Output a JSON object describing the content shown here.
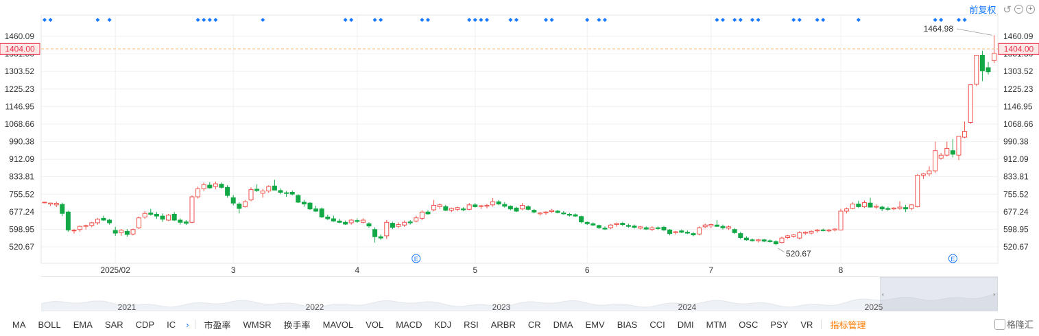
{
  "header": {
    "adjust_label": "前复权"
  },
  "icons": {
    "undo": "undo-icon",
    "zoom_out": "zoom-out-icon",
    "zoom_in": "zoom-in-icon",
    "event": "event-marker-icon",
    "dividend": "dividend-marker-icon"
  },
  "colors": {
    "up": "#f0504a",
    "down": "#12a846",
    "accent": "#1677ff",
    "price_line": "#f5a35a",
    "price_tag": "#e8344b"
  },
  "current_price": {
    "label": "1404.00",
    "value": 1404.0
  },
  "chart_data": {
    "type": "candlestick",
    "ylim": [
      480,
      1500
    ],
    "y_ticks": [
      "1460.09",
      "1381.80",
      "1303.52",
      "1225.23",
      "1146.95",
      "1068.66",
      "990.38",
      "912.09",
      "833.81",
      "755.52",
      "677.24",
      "598.95",
      "520.67"
    ],
    "x_ticks": [
      {
        "label": "2025/02",
        "i": 13
      },
      {
        "label": "3",
        "i": 33
      },
      {
        "label": "4",
        "i": 54
      },
      {
        "label": "5",
        "i": 74
      },
      {
        "label": "6",
        "i": 93
      },
      {
        "label": "7",
        "i": 114
      },
      {
        "label": "8",
        "i": 136
      }
    ],
    "annotations": {
      "max_label": "1464.98",
      "max_value": 1464.98,
      "min_label": "520.67",
      "min_value": 520.67
    },
    "events_at": [
      1,
      2,
      10,
      12,
      27,
      28,
      29,
      30,
      38,
      52,
      53,
      57,
      58,
      65,
      66,
      73,
      74,
      75,
      76,
      80,
      81,
      86,
      87,
      93,
      95,
      96,
      115,
      116,
      118,
      119,
      121,
      122,
      128,
      129,
      132,
      133,
      139,
      152,
      153,
      156,
      157
    ],
    "dividend_markers_at": [
      64,
      155
    ],
    "candles": [
      [
        1,
        720,
        722,
        715,
        720
      ],
      [
        2,
        712,
        718,
        703,
        716
      ],
      [
        3,
        708,
        722,
        698,
        715
      ],
      [
        4,
        710,
        718,
        658,
        670
      ],
      [
        5,
        676,
        682,
        588,
        596
      ],
      [
        6,
        592,
        600,
        580,
        595
      ],
      [
        7,
        598,
        616,
        588,
        612
      ],
      [
        8,
        612,
        620,
        598,
        616
      ],
      [
        9,
        616,
        632,
        608,
        628
      ],
      [
        10,
        628,
        650,
        620,
        644
      ],
      [
        11,
        648,
        660,
        636,
        640
      ],
      [
        12,
        640,
        646,
        620,
        628
      ],
      [
        13,
        594,
        610,
        570,
        582
      ],
      [
        14,
        584,
        600,
        570,
        595
      ],
      [
        15,
        590,
        600,
        566,
        576
      ],
      [
        16,
        578,
        602,
        572,
        598
      ],
      [
        17,
        606,
        656,
        600,
        650
      ],
      [
        18,
        654,
        680,
        646,
        670
      ],
      [
        19,
        672,
        690,
        660,
        666
      ],
      [
        20,
        666,
        676,
        646,
        658
      ],
      [
        21,
        658,
        670,
        632,
        644
      ],
      [
        22,
        640,
        668,
        636,
        662
      ],
      [
        23,
        666,
        676,
        636,
        640
      ],
      [
        24,
        640,
        648,
        620,
        630
      ],
      [
        25,
        632,
        640,
        618,
        626
      ],
      [
        26,
        630,
        750,
        626,
        744
      ],
      [
        27,
        744,
        790,
        736,
        780
      ],
      [
        28,
        780,
        808,
        770,
        798
      ],
      [
        29,
        796,
        810,
        780,
        784
      ],
      [
        30,
        790,
        812,
        778,
        802
      ],
      [
        31,
        800,
        808,
        780,
        786
      ],
      [
        32,
        786,
        796,
        740,
        750
      ],
      [
        33,
        740,
        752,
        706,
        716
      ],
      [
        34,
        712,
        720,
        670,
        692
      ],
      [
        35,
        700,
        730,
        696,
        722
      ],
      [
        36,
        730,
        786,
        724,
        776
      ],
      [
        37,
        778,
        800,
        766,
        772
      ],
      [
        38,
        760,
        780,
        740,
        770
      ],
      [
        39,
        770,
        796,
        762,
        790
      ],
      [
        40,
        792,
        820,
        784,
        774
      ],
      [
        41,
        772,
        782,
        756,
        764
      ],
      [
        42,
        762,
        770,
        744,
        760
      ],
      [
        43,
        764,
        772,
        750,
        756
      ],
      [
        44,
        750,
        756,
        716,
        720
      ],
      [
        45,
        720,
        730,
        700,
        712
      ],
      [
        46,
        716,
        720,
        686,
        690
      ],
      [
        47,
        690,
        704,
        676,
        680
      ],
      [
        48,
        690,
        696,
        650,
        654
      ],
      [
        49,
        654,
        664,
        640,
        646
      ],
      [
        50,
        646,
        660,
        632,
        636
      ],
      [
        51,
        636,
        646,
        626,
        630
      ],
      [
        52,
        630,
        638,
        618,
        622
      ],
      [
        53,
        628,
        644,
        620,
        640
      ],
      [
        54,
        638,
        648,
        628,
        634
      ],
      [
        55,
        630,
        648,
        626,
        640
      ],
      [
        56,
        624,
        630,
        606,
        614
      ],
      [
        57,
        598,
        608,
        540,
        566
      ],
      [
        58,
        566,
        576,
        552,
        560
      ],
      [
        59,
        570,
        640,
        556,
        630
      ],
      [
        60,
        626,
        632,
        600,
        608
      ],
      [
        61,
        612,
        630,
        604,
        620
      ],
      [
        62,
        618,
        638,
        610,
        630
      ],
      [
        63,
        632,
        640,
        620,
        628
      ],
      [
        64,
        636,
        660,
        630,
        650
      ],
      [
        65,
        648,
        684,
        640,
        676
      ],
      [
        66,
        676,
        684,
        664,
        668
      ],
      [
        67,
        686,
        730,
        680,
        706
      ],
      [
        68,
        700,
        714,
        690,
        708
      ],
      [
        69,
        700,
        708,
        680,
        684
      ],
      [
        70,
        684,
        696,
        676,
        692
      ],
      [
        71,
        688,
        700,
        680,
        696
      ],
      [
        72,
        690,
        698,
        680,
        686
      ],
      [
        73,
        688,
        716,
        684,
        708
      ],
      [
        74,
        708,
        716,
        696,
        700
      ],
      [
        75,
        702,
        708,
        690,
        704
      ],
      [
        76,
        702,
        712,
        692,
        706
      ],
      [
        77,
        708,
        738,
        700,
        722
      ],
      [
        78,
        722,
        730,
        706,
        712
      ],
      [
        79,
        710,
        720,
        696,
        702
      ],
      [
        80,
        702,
        706,
        684,
        690
      ],
      [
        81,
        694,
        700,
        676,
        680
      ],
      [
        82,
        690,
        716,
        684,
        706
      ],
      [
        83,
        700,
        706,
        684,
        688
      ],
      [
        84,
        684,
        690,
        670,
        676
      ],
      [
        85,
        668,
        676,
        660,
        672
      ],
      [
        86,
        672,
        680,
        664,
        676
      ],
      [
        87,
        678,
        690,
        672,
        684
      ],
      [
        88,
        680,
        686,
        670,
        674
      ],
      [
        89,
        672,
        680,
        664,
        668
      ],
      [
        90,
        666,
        672,
        656,
        662
      ],
      [
        91,
        664,
        670,
        654,
        658
      ],
      [
        92,
        656,
        660,
        626,
        632
      ],
      [
        93,
        630,
        634,
        618,
        624
      ],
      [
        94,
        624,
        630,
        614,
        618
      ],
      [
        95,
        616,
        620,
        600,
        606
      ],
      [
        96,
        604,
        612,
        596,
        600
      ],
      [
        97,
        606,
        622,
        600,
        618
      ],
      [
        98,
        620,
        630,
        610,
        626
      ],
      [
        99,
        626,
        632,
        614,
        620
      ],
      [
        100,
        616,
        624,
        606,
        612
      ],
      [
        101,
        614,
        620,
        602,
        608
      ],
      [
        102,
        604,
        614,
        598,
        610
      ],
      [
        103,
        606,
        612,
        596,
        600
      ],
      [
        104,
        598,
        612,
        592,
        606
      ],
      [
        105,
        606,
        612,
        596,
        602
      ],
      [
        106,
        608,
        614,
        592,
        596
      ],
      [
        107,
        596,
        600,
        572,
        580
      ],
      [
        108,
        584,
        592,
        576,
        588
      ],
      [
        109,
        592,
        598,
        582,
        586
      ],
      [
        110,
        586,
        594,
        578,
        582
      ],
      [
        111,
        580,
        586,
        568,
        574
      ],
      [
        112,
        578,
        612,
        572,
        606
      ],
      [
        113,
        610,
        624,
        604,
        618
      ],
      [
        114,
        614,
        624,
        604,
        620
      ],
      [
        115,
        618,
        640,
        610,
        612
      ],
      [
        116,
        612,
        620,
        598,
        606
      ],
      [
        117,
        604,
        616,
        596,
        610
      ],
      [
        118,
        598,
        604,
        578,
        584
      ],
      [
        119,
        580,
        588,
        554,
        562
      ],
      [
        120,
        560,
        568,
        548,
        552
      ],
      [
        121,
        552,
        558,
        544,
        548
      ],
      [
        122,
        548,
        556,
        540,
        552
      ],
      [
        123,
        552,
        556,
        542,
        546
      ],
      [
        124,
        548,
        554,
        540,
        544
      ],
      [
        125,
        544,
        550,
        528,
        534
      ],
      [
        126,
        540,
        566,
        536,
        560
      ],
      [
        127,
        562,
        574,
        556,
        570
      ],
      [
        128,
        568,
        578,
        562,
        574
      ],
      [
        129,
        560,
        590,
        554,
        584
      ],
      [
        130,
        582,
        590,
        574,
        586
      ],
      [
        131,
        582,
        594,
        576,
        590
      ],
      [
        132,
        592,
        600,
        584,
        596
      ],
      [
        133,
        596,
        602,
        590,
        594
      ],
      [
        134,
        592,
        600,
        586,
        596
      ],
      [
        135,
        596,
        604,
        590,
        600
      ],
      [
        136,
        596,
        690,
        594,
        680
      ],
      [
        137,
        680,
        696,
        670,
        690
      ],
      [
        138,
        692,
        720,
        688,
        712
      ],
      [
        139,
        712,
        726,
        694,
        700
      ],
      [
        140,
        700,
        728,
        694,
        718
      ],
      [
        141,
        716,
        740,
        708,
        698
      ],
      [
        142,
        698,
        710,
        690,
        702
      ],
      [
        143,
        698,
        704,
        680,
        690
      ],
      [
        144,
        692,
        700,
        682,
        688
      ],
      [
        145,
        690,
        698,
        684,
        694
      ],
      [
        146,
        692,
        724,
        686,
        698
      ],
      [
        147,
        696,
        708,
        676,
        690
      ],
      [
        148,
        692,
        710,
        684,
        708
      ],
      [
        149,
        700,
        846,
        696,
        840
      ],
      [
        150,
        840,
        850,
        824,
        846
      ],
      [
        151,
        846,
        880,
        836,
        860
      ],
      [
        152,
        860,
        990,
        850,
        950
      ],
      [
        153,
        916,
        940,
        910,
        930
      ],
      [
        154,
        930,
        990,
        924,
        960
      ],
      [
        155,
        950,
        1002,
        920,
        934
      ],
      [
        156,
        930,
        1010,
        908,
        1014
      ],
      [
        157,
        1010,
        1080,
        1006,
        1036
      ],
      [
        158,
        1076,
        1110,
        1070,
        1244
      ],
      [
        159,
        1246,
        1270,
        1238,
        1376
      ],
      [
        160,
        1376,
        1396,
        1260,
        1306
      ],
      [
        161,
        1320,
        1346,
        1290,
        1302
      ],
      [
        162,
        1352,
        1464.98,
        1340,
        1384
      ]
    ]
  },
  "navigator": {
    "years": [
      "2021",
      "2022",
      "2023",
      "2024",
      "2025"
    ]
  },
  "toolbar": {
    "items": [
      "MA",
      "BOLL",
      "EMA",
      "SAR",
      "CDP",
      "IC"
    ],
    "chevron": "›",
    "items2": [
      "市盈率",
      "WMSR",
      "换手率",
      "MAVOL",
      "VOL",
      "MACD",
      "KDJ",
      "RSI",
      "ARBR",
      "CR",
      "DMA",
      "EMV",
      "BIAS",
      "CCI",
      "DMI",
      "MTM",
      "OSC",
      "PSY",
      "VR"
    ],
    "manage": "指标管理"
  },
  "brand": {
    "text": "格隆汇"
  }
}
